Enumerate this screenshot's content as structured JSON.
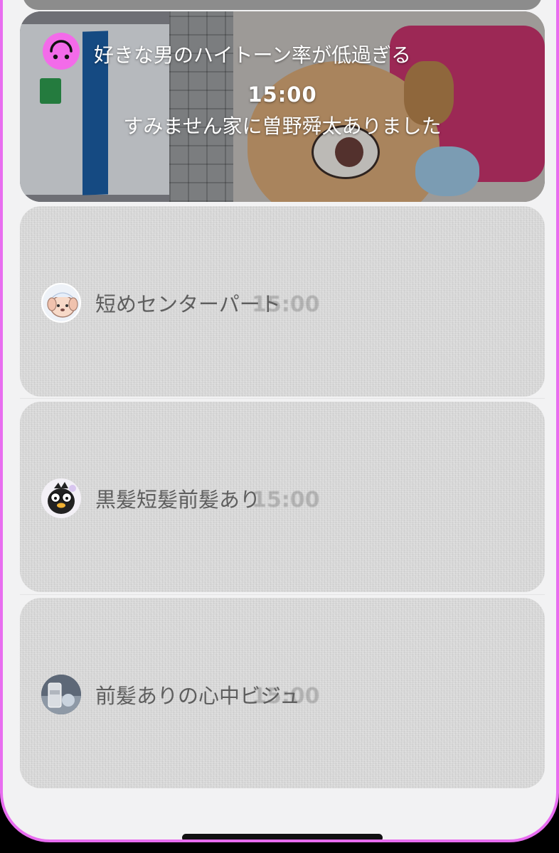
{
  "hero": {
    "title": "好きな男のハイトーン率が低過ぎる",
    "time": "15:00",
    "subtitle": "すみません家に曽野舜太ありました",
    "avatar_icon": "upside-down-smile-icon",
    "avatar_color": "#f36be9"
  },
  "items": [
    {
      "label": "短めセンターパート",
      "ghost_time": "15:00",
      "avatar_icon": "puppy-avatar-icon"
    },
    {
      "label": "黒髪短髪前髪あり",
      "ghost_time": "15:00",
      "avatar_icon": "penguin-avatar-icon"
    },
    {
      "label": "前髪ありの心中ビジュ",
      "ghost_time": "15:00",
      "avatar_icon": "jar-photo-avatar-icon"
    }
  ],
  "colors": {
    "frame_border": "#e86df0",
    "background": "#f2f2f3",
    "card": "#d7d7d7",
    "label_text": "#5e5e5e"
  }
}
